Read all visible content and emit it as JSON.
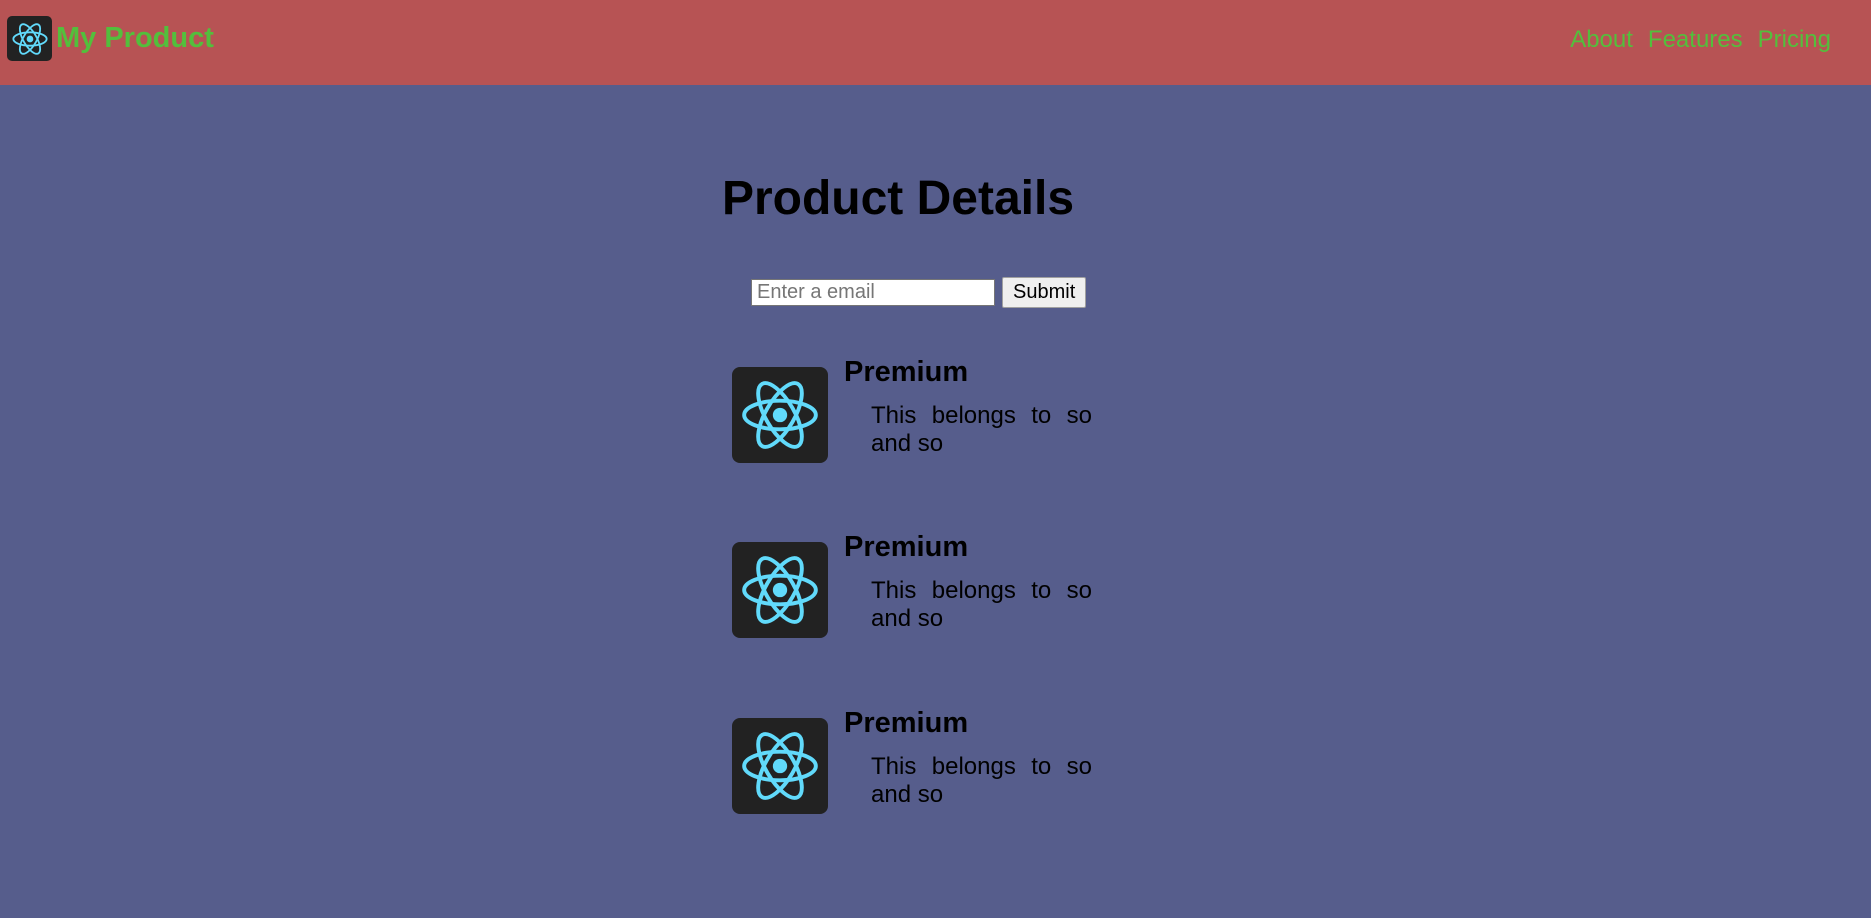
{
  "navbar": {
    "brand_name": "My Product",
    "logo_icon": "react-atom-icon",
    "links": [
      {
        "label": "About"
      },
      {
        "label": "Features"
      },
      {
        "label": "Pricing"
      }
    ]
  },
  "main": {
    "title": "Product Details",
    "email_placeholder": "Enter a email",
    "submit_label": "Submit",
    "features": [
      {
        "heading": "Premium",
        "description": "This belongs to so and so",
        "icon": "react-atom-icon"
      },
      {
        "heading": "Premium",
        "description": "This belongs to so and so",
        "icon": "react-atom-icon"
      },
      {
        "heading": "Premium",
        "description": "This belongs to so and so",
        "icon": "react-atom-icon"
      }
    ]
  },
  "colors": {
    "navbar_bg": "#b75354",
    "page_bg": "#565d8c",
    "accent_green": "#53bf3c",
    "icon_bg": "#222222",
    "icon_cyan": "#61dafb"
  }
}
